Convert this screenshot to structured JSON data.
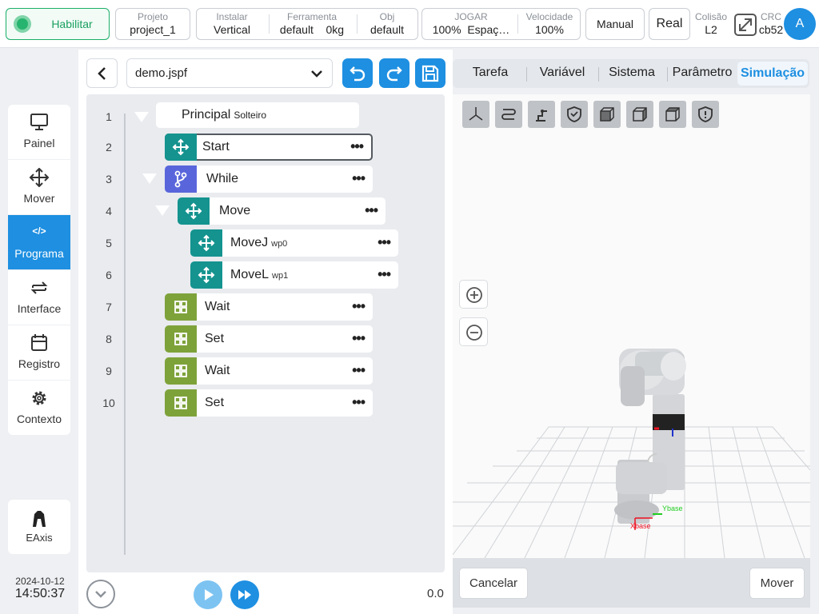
{
  "topbar": {
    "enable_label": "Habilitar",
    "project": {
      "key": "Projeto",
      "value": "project_1"
    },
    "install": {
      "key": "Instalar",
      "value": "Vertical"
    },
    "tool": {
      "key": "Ferramenta",
      "value": "default",
      "weight": "0kg"
    },
    "obj": {
      "key": "Obj",
      "value": "default"
    },
    "jog": {
      "key": "JOGAR",
      "value": "100%",
      "space": "Espaç…"
    },
    "speed": {
      "key": "Velocidade",
      "value": "100%"
    },
    "manual_label": "Manual",
    "real_label": "Real",
    "collision": {
      "key": "Colisão",
      "value": "L2"
    },
    "crc": {
      "key": "CRC",
      "value": "cb52"
    },
    "avatar": "A"
  },
  "sidebar": {
    "items": [
      {
        "label": "Painel",
        "icon": "monitor-icon"
      },
      {
        "label": "Mover",
        "icon": "move-arrows-icon"
      },
      {
        "label": "Programa",
        "icon": "code-icon",
        "glyph": "</>"
      },
      {
        "label": "Interface",
        "icon": "swap-icon"
      },
      {
        "label": "Registro",
        "icon": "calendar-icon"
      },
      {
        "label": "Contexto",
        "icon": "gear-icon"
      }
    ],
    "active": "Programa",
    "eaxis_label": "EAxis"
  },
  "datetime": {
    "date": "2024-10-12",
    "time": "14:50:37"
  },
  "program": {
    "file": "demo.jspf",
    "tree": [
      {
        "line": "1",
        "label": "Principal",
        "sub": "Solteiro"
      },
      {
        "line": "2",
        "label": "Start",
        "sub": ""
      },
      {
        "line": "3",
        "label": "While",
        "sub": ""
      },
      {
        "line": "4",
        "label": "Move",
        "sub": ""
      },
      {
        "line": "5",
        "label": "MoveJ",
        "sub": "wp0"
      },
      {
        "line": "6",
        "label": "MoveL",
        "sub": "wp1"
      },
      {
        "line": "7",
        "label": "Wait",
        "sub": ""
      },
      {
        "line": "8",
        "label": "Set",
        "sub": ""
      },
      {
        "line": "9",
        "label": "Wait",
        "sub": ""
      },
      {
        "line": "10",
        "label": "Set",
        "sub": ""
      }
    ],
    "more_glyph": "•••",
    "progress_value": "0.0"
  },
  "colors": {
    "accent": "#1e8fe1",
    "enable_green": "#27b46e",
    "teal": "#14938f",
    "purple": "#5966db",
    "olive": "#7ea23a"
  },
  "sim": {
    "tabs": [
      "Tarefa",
      "Variável",
      "Sistema",
      "Parâmetro",
      "Simulação"
    ],
    "active_tab": "Simulação",
    "view_buttons": [
      "axes-icon",
      "path-icon",
      "robot-icon",
      "shield-check-icon",
      "cube-front-icon",
      "cube-side-icon",
      "cube-top-icon",
      "shield-alert-icon"
    ],
    "axis_x": "Xbase",
    "axis_y": "Ybase",
    "cancel_label": "Cancelar",
    "move_label": "Mover"
  }
}
